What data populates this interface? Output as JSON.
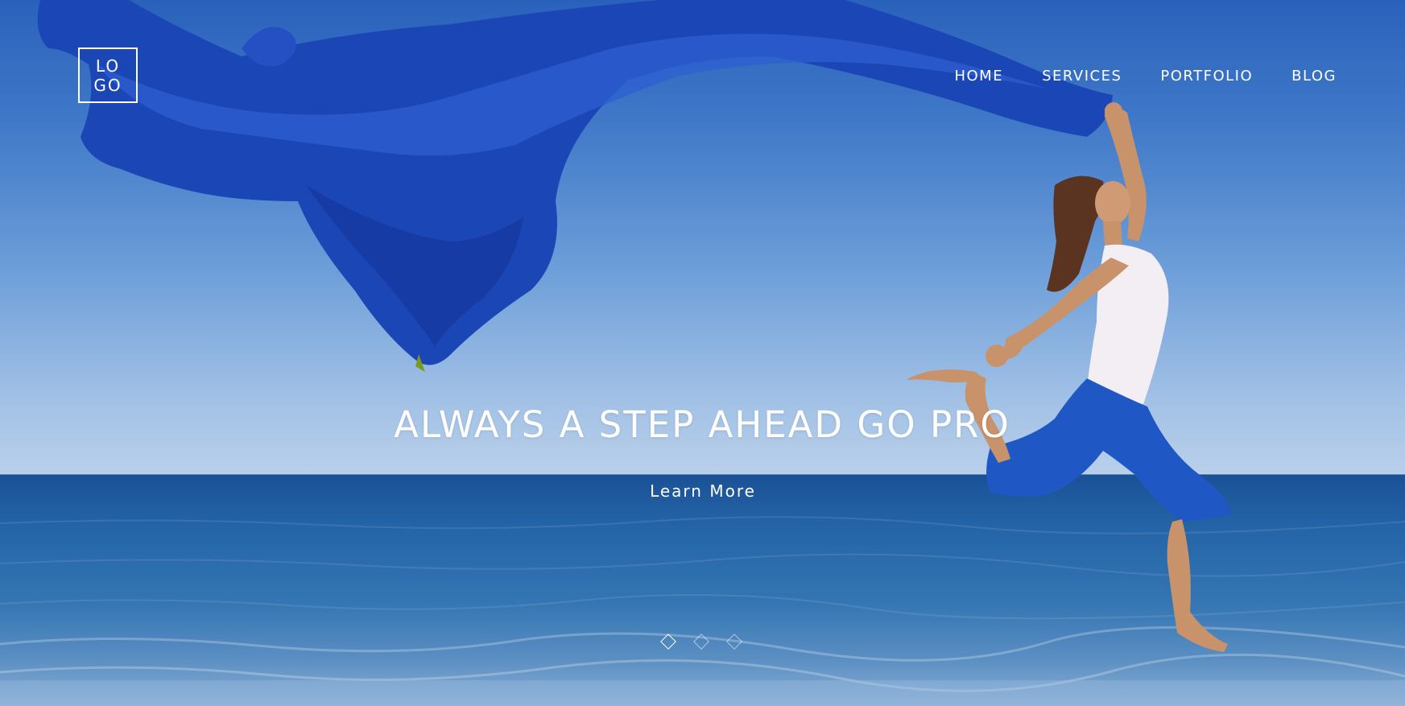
{
  "brand": {
    "logo_line1": "LO",
    "logo_line2": "GO"
  },
  "nav": {
    "items": [
      {
        "label": "HOME"
      },
      {
        "label": "SERVICES"
      },
      {
        "label": "PORTFOLIO"
      },
      {
        "label": "BLOG"
      }
    ]
  },
  "hero": {
    "headline": "ALWAYS A STEP AHEAD GO PRO",
    "cta_label": "Learn More",
    "background_icon": "beach-jump-photo",
    "slides_total": 3,
    "active_slide": 1
  },
  "colors": {
    "sky_top": "#2a62bb",
    "sky_bottom": "#b9d0ea",
    "sea": "#2566a9",
    "fabric": "#1a45b8",
    "text": "#ffffff"
  }
}
